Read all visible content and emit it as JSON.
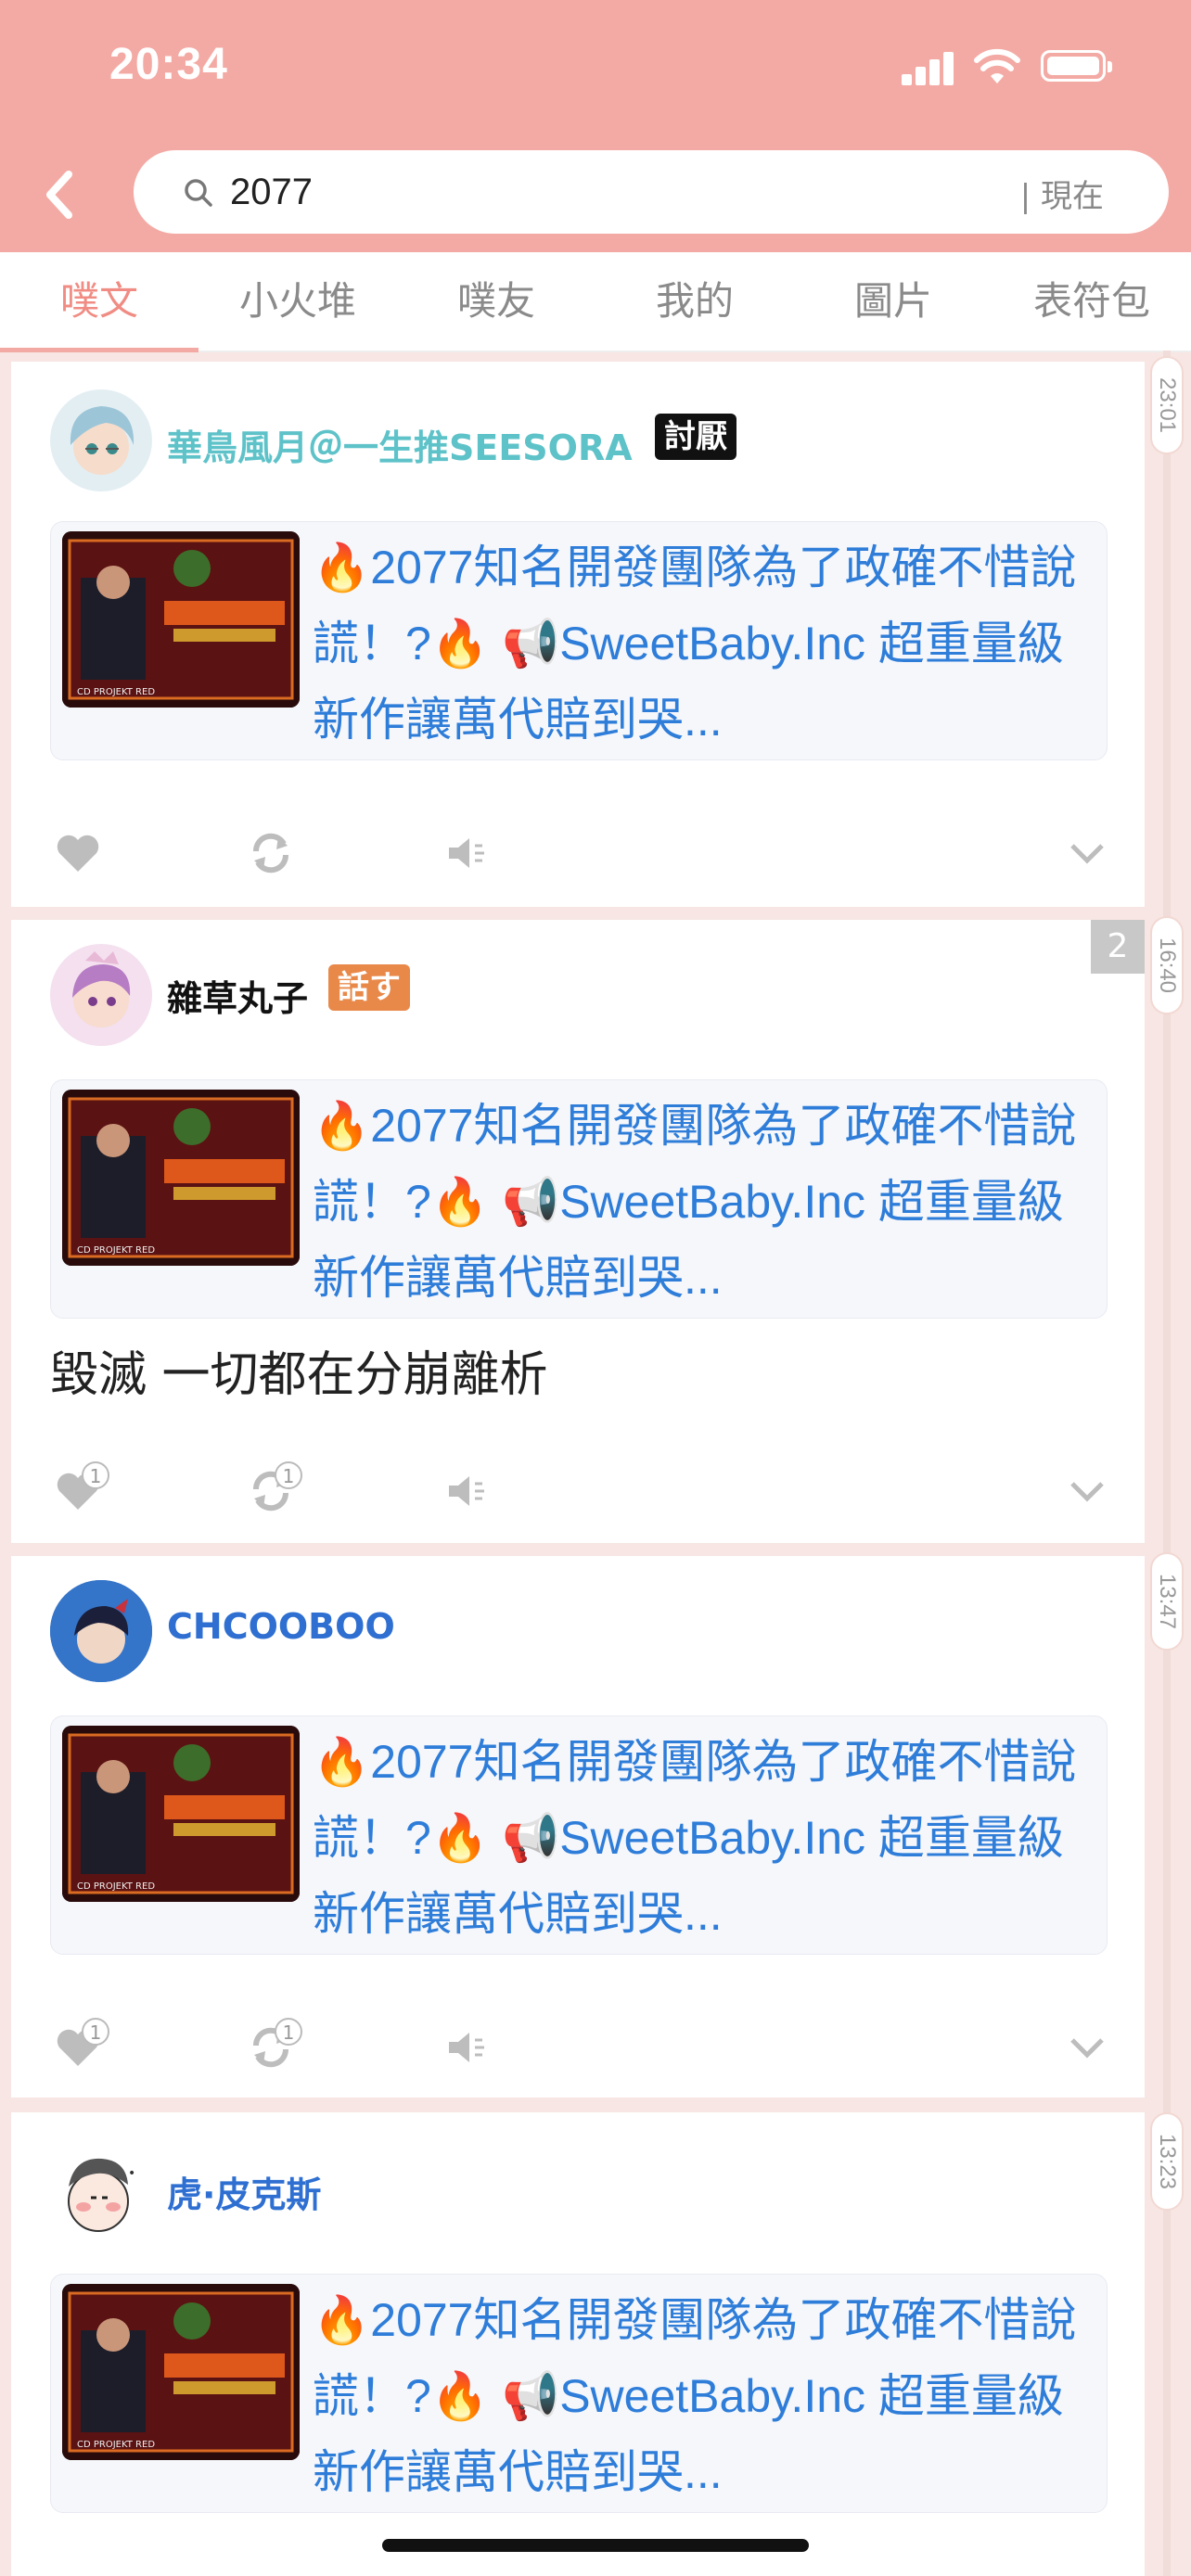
{
  "status_bar": {
    "time": "20:34"
  },
  "search": {
    "query": "2077",
    "scope": "| 現在"
  },
  "tabs": [
    {
      "label": "噗文",
      "active": true
    },
    {
      "label": "小火堆"
    },
    {
      "label": "噗友"
    },
    {
      "label": "我的"
    },
    {
      "label": "圖片"
    },
    {
      "label": "表符包"
    }
  ],
  "posts": [
    {
      "username": "華鳥風月＠一生推SEESORA",
      "username_color": "#5ec2c9",
      "badge": "討厭",
      "badge_color": "#111111",
      "link_text": "🔥2077知名開發團隊為了政確不惜說謊！?🔥 📢SweetBaby.Inc 超重量級新作讓萬代賠到哭...",
      "timestamp": "23:01",
      "likes": "",
      "replurks": ""
    },
    {
      "username": "雜草丸子",
      "username_color": "#111111",
      "badge": "話す",
      "badge_color": "#e8894a",
      "link_text": "🔥2077知名開發團隊為了政確不惜說謊！?🔥 📢SweetBaby.Inc 超重量級新作讓萬代賠到哭...",
      "text": "毀滅 一切都在分崩離析",
      "timestamp": "16:40",
      "unread_count": "2",
      "likes": "1",
      "replurks": "1"
    },
    {
      "username": "CHCOOBOO",
      "username_color": "#2e6fd1",
      "link_text": "🔥2077知名開發團隊為了政確不惜說謊！?🔥 📢SweetBaby.Inc 超重量級新作讓萬代賠到哭...",
      "timestamp": "13:47",
      "likes": "1",
      "replurks": "1"
    },
    {
      "username": "虎·皮克斯",
      "username_color": "#2e6fd1",
      "link_text": "🔥2077知名開發團隊為了政確不惜說謊！?🔥 📢SweetBaby.Inc 超重量級新作讓萬代賠到哭...",
      "timestamp": "13:23"
    }
  ],
  "colors": {
    "header": "#f4aaa4",
    "accent": "#f08c83",
    "link": "#2e7dd9"
  },
  "icons": [
    "back-chevron-icon",
    "search-icon",
    "heart-icon",
    "replurk-icon",
    "mute-icon",
    "expand-chevron-icon"
  ]
}
